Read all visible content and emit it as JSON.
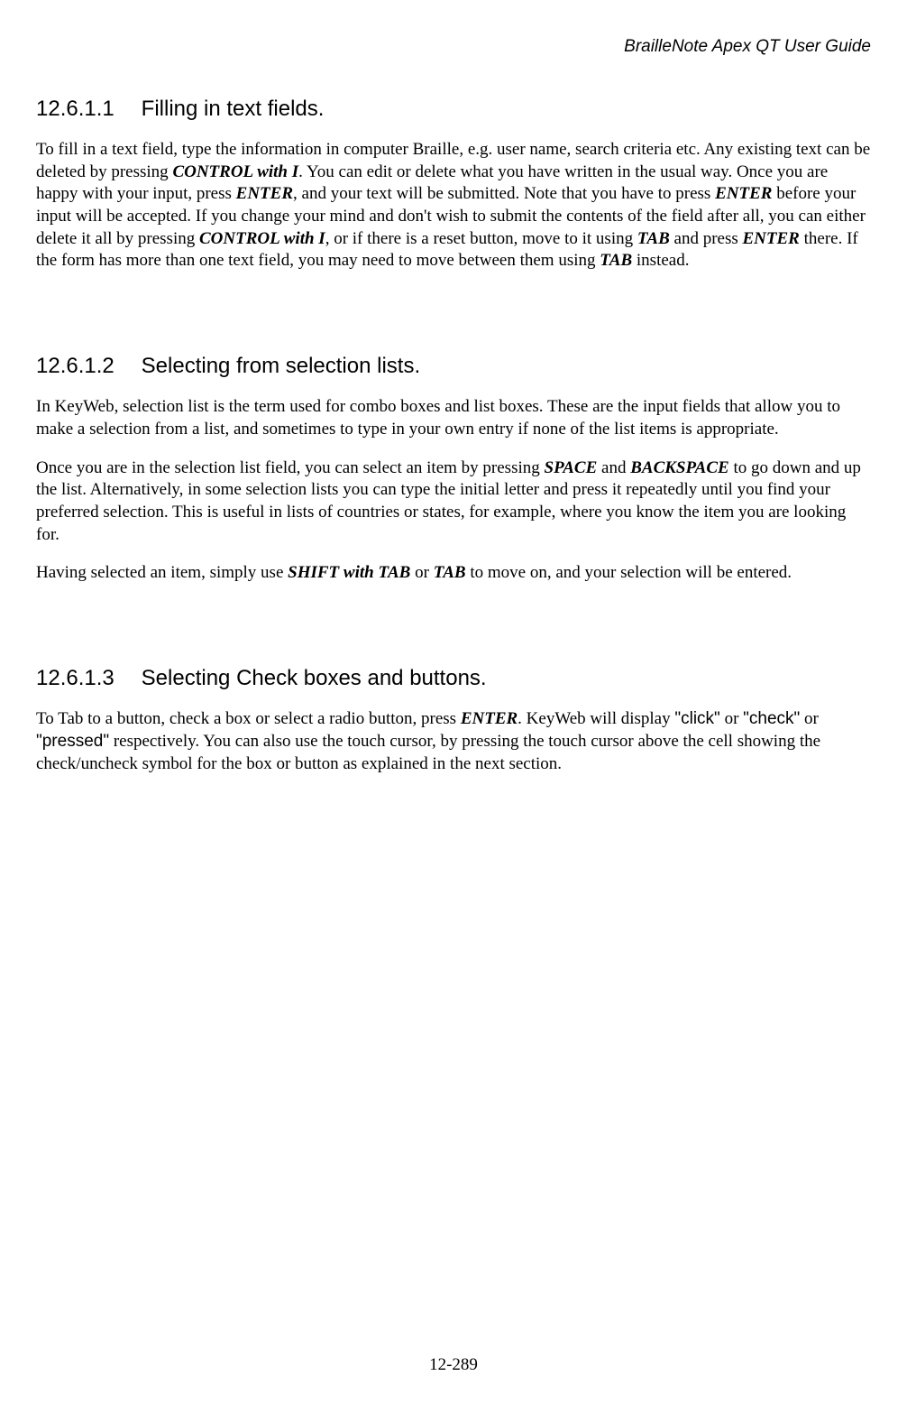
{
  "header": "BrailleNote Apex QT User Guide",
  "sections": [
    {
      "num": "12.6.1.1",
      "title": "Filling in text fields.",
      "paragraphs": [
        {
          "runs": [
            {
              "t": "To fill in a text field, type the information in computer Braille, e.g. user name, search criteria etc. Any existing text can be deleted by pressing "
            },
            {
              "t": "CONTROL with I",
              "cls": "bi"
            },
            {
              "t": ". You can edit or delete what you have written in the usual way. Once you are happy with your input, press "
            },
            {
              "t": "ENTER",
              "cls": "bi"
            },
            {
              "t": ", and your text will be submitted. Note that you have to press "
            },
            {
              "t": "ENTER",
              "cls": "bi"
            },
            {
              "t": " before your input will be accepted. If you change your mind and don't wish to submit the contents of the field after all, you can either delete it all by pressing "
            },
            {
              "t": "CONTROL with I",
              "cls": "bi"
            },
            {
              "t": ", or if there is a reset button, move to it using "
            },
            {
              "t": "TAB",
              "cls": "bi"
            },
            {
              "t": " and press "
            },
            {
              "t": "ENTER",
              "cls": "bi"
            },
            {
              "t": " there. If the form has more than one text field, you may need to move between them using "
            },
            {
              "t": "TAB",
              "cls": "bi"
            },
            {
              "t": " instead."
            }
          ]
        }
      ]
    },
    {
      "num": "12.6.1.2",
      "title": "Selecting from selection lists.",
      "paragraphs": [
        {
          "runs": [
            {
              "t": "In KeyWeb, selection list is the term used for combo boxes and list boxes. These are the input fields that allow you to make a selection from a list, and sometimes to type in your own entry if none of the list items is appropriate."
            }
          ]
        },
        {
          "runs": [
            {
              "t": "Once you are in the selection list field, you can select an item by pressing "
            },
            {
              "t": "SPACE",
              "cls": "bi"
            },
            {
              "t": " and "
            },
            {
              "t": "BACKSPACE",
              "cls": "bi"
            },
            {
              "t": " to go down and up the list. Alternatively, in some selection lists you can type the initial letter and press it repeatedly until you find your preferred selection. This is useful in lists of countries or states, for example, where you know the item you are looking for."
            }
          ]
        },
        {
          "runs": [
            {
              "t": "Having selected an item, simply use "
            },
            {
              "t": "SHIFT with TAB",
              "cls": "bi"
            },
            {
              "t": " or "
            },
            {
              "t": "TAB",
              "cls": "bi"
            },
            {
              "t": " to move on, and your selection will be entered."
            }
          ]
        }
      ]
    },
    {
      "num": "12.6.1.3",
      "title": "Selecting Check boxes and buttons.",
      "paragraphs": [
        {
          "runs": [
            {
              "t": "To Tab to a button, check a box or select a radio button, press "
            },
            {
              "t": "ENTER",
              "cls": "bi"
            },
            {
              "t": ". KeyWeb will display "
            },
            {
              "t": "\"click\"",
              "cls": "sans-quote"
            },
            {
              "t": " or "
            },
            {
              "t": "\"check\"",
              "cls": "sans-quote"
            },
            {
              "t": " or "
            },
            {
              "t": "\"pressed\"",
              "cls": "sans-quote"
            },
            {
              "t": " respectively. You can also use the touch cursor, by pressing the touch cursor above the cell showing the check/uncheck symbol for the box or button as explained in the next section."
            }
          ]
        }
      ]
    }
  ],
  "footer": "12-289"
}
